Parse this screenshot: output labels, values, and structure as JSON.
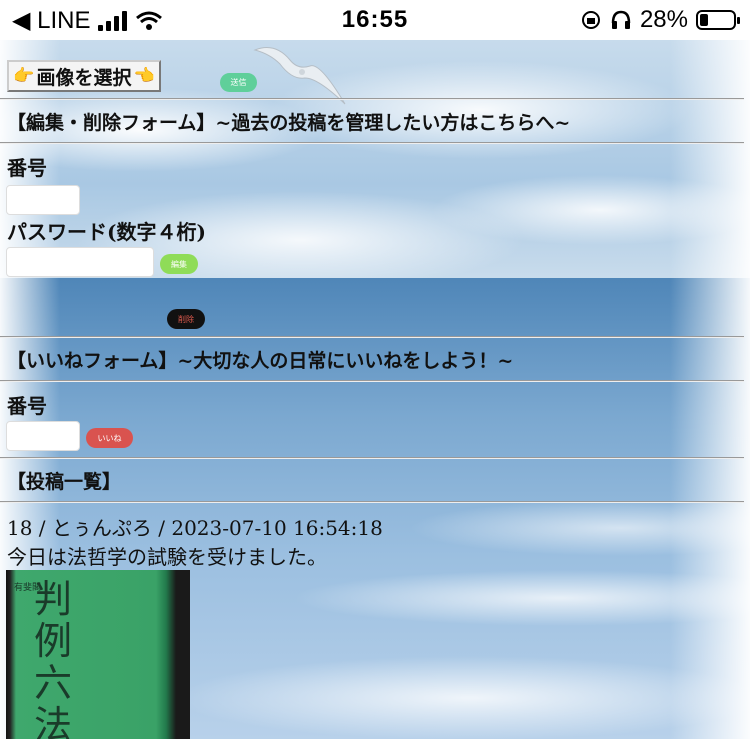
{
  "status_bar": {
    "back_app": "◀ LINE",
    "time": "16:55",
    "battery_pct": "28%"
  },
  "toolbar": {
    "select_image": "画像を選択",
    "send": "送信"
  },
  "edit_form": {
    "heading": "【編集・削除フォーム】~過去の投稿を管理したい方はこちらへ~",
    "number_label": "番号",
    "password_label": "パスワード(数字４桁)",
    "edit_button": "編集",
    "delete_button": "削除"
  },
  "like_form": {
    "heading": "【いいねフォーム】~大切な人の日常にいいねをしよう！~",
    "number_label": "番号",
    "like_button": "いいね"
  },
  "posts": {
    "heading": "【投稿一覧】",
    "items": [
      {
        "meta": "18 / とぅんぷろ / 2023-07-10 16:54:18",
        "text": "今日は法哲学の試験を受けました。",
        "image_text": "判例六法",
        "image_small": "有斐閣"
      }
    ]
  },
  "colors": {
    "send": "#5fcf9a",
    "edit": "#8fdc58",
    "delete": "#111111",
    "like": "#d9534f"
  }
}
